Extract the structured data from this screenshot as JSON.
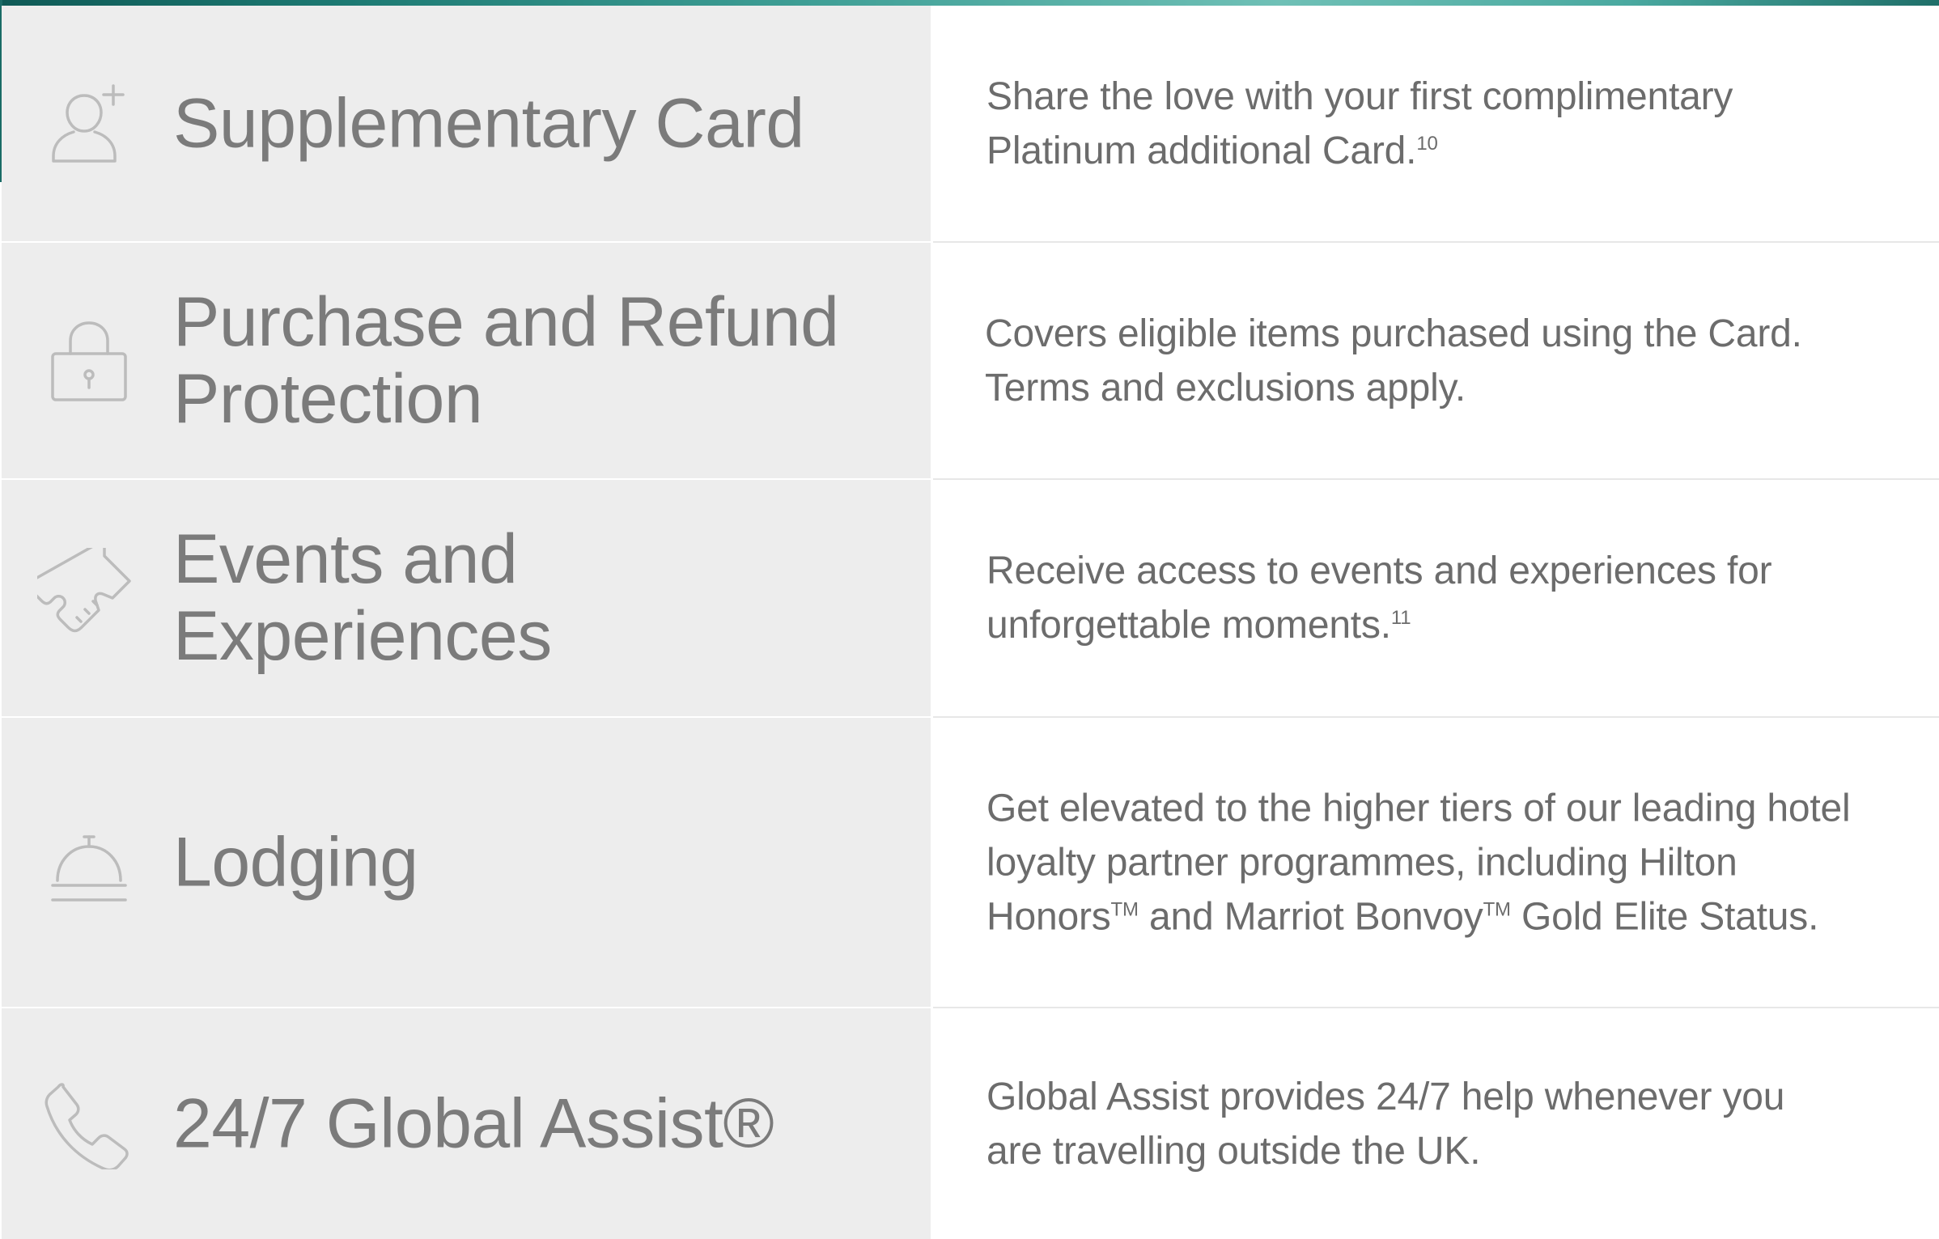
{
  "benefits": [
    {
      "icon": "supplementary-card-person-plus-icon",
      "title": "Supplementary Card",
      "description": "Share the love with your first complimentary Platinum additional Card.",
      "footnote": "10"
    },
    {
      "icon": "lock-icon",
      "title": "Purchase and Refund Protection",
      "description": "Covers eligible items purchased using the Card. Terms and exclusions apply."
    },
    {
      "icon": "ticket-icon",
      "title": "Events and Experiences",
      "description": "Receive access to events and experiences for unforgettable moments.",
      "footnote": "11"
    },
    {
      "icon": "hotel-bell-icon",
      "title": "Lodging",
      "description_part1": "Get elevated to the higher tiers of our leading hotel loyalty partner programmes, including Hilton Honors",
      "trademark": "TM",
      "description_part2": " and Marriot Bonvoy",
      "description_part3": " Gold Elite Status."
    },
    {
      "icon": "phone-icon",
      "title": "24/7 Global Assist®",
      "description": "Global Assist provides 24/7 help whenever you are travelling outside the UK."
    }
  ],
  "colors": {
    "left_cell": "#ededed",
    "right_cell": "#ffffff",
    "title_text": "#7b7b7b",
    "description_text": "#6c6c6c",
    "top_strip": "#2f8b84"
  }
}
